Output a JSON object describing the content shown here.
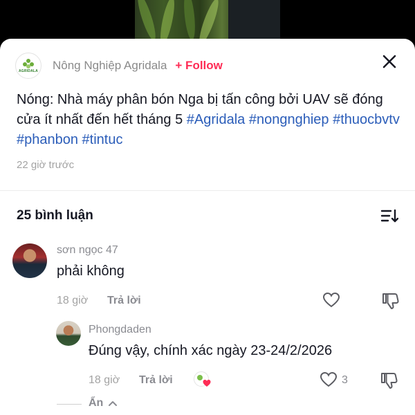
{
  "post": {
    "account_name": "Nông Nghiệp Agridala",
    "logo_text": "AGRIDALA",
    "follow_label": "+ Follow",
    "caption_text": "Nóng: Nhà máy phân bón Nga bị tấn công bởi UAV sẽ đóng cửa ít nhất đến hết tháng 5 ",
    "hashtags": [
      "#Agridala",
      "#nongnghiep",
      "#thuocbvtv",
      "#phanbon",
      "#tintuc"
    ],
    "time": "22 giờ trước"
  },
  "comments_header": {
    "count_label": "25 bình luận"
  },
  "comments": [
    {
      "author": "sơn ngọc 47",
      "text": "phải không",
      "time": "18 giờ",
      "reply_label": "Trả lời"
    }
  ],
  "reply": {
    "author": "Phongdaden",
    "text": "Đúng vậy, chính xác ngày 23-24/2/2026",
    "time": "18 giờ",
    "reply_label": "Trả lời",
    "like_count": "3"
  },
  "hide_label": "Ẩn",
  "colors": {
    "follow": "#fe2c55",
    "hashtag": "#2b5db9",
    "heart": "#fe2c55"
  },
  "icons": [
    "close-icon",
    "sort-icon",
    "heart-outline-icon",
    "dislike-icon",
    "creator-liked-badge",
    "chevron-up-icon"
  ]
}
